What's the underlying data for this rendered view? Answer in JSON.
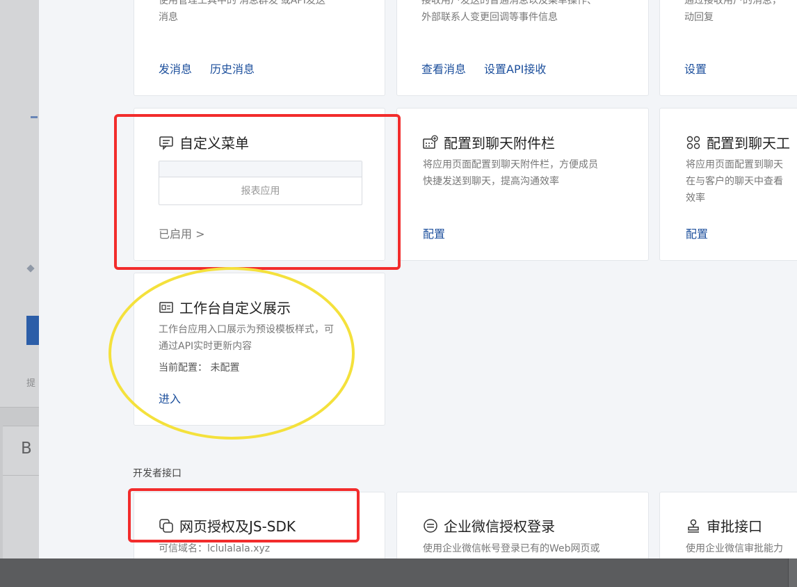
{
  "sidebar": {
    "tip_text": "提",
    "panel_letter": "B"
  },
  "cards": {
    "send_message": {
      "desc_line1": "使用管理工具中的'消息群发'或API发送",
      "desc_line2": "消息",
      "links": [
        "发消息",
        "历史消息"
      ]
    },
    "receive_message": {
      "desc_line1": "接收用户发送的普通消息以及菜单操作、",
      "desc_line2": "外部联系人变更回调等事件信息",
      "links": [
        "查看消息",
        "设置API接收"
      ]
    },
    "auto_reply": {
      "desc_line1": "通过接收用户的消息，",
      "desc_line2": "动回复",
      "links": [
        "设置"
      ]
    },
    "custom_menu": {
      "title": "自定义菜单",
      "icon": "menu-icon",
      "preview_label": "报表应用",
      "status": "已启用 >"
    },
    "chat_attachment": {
      "title": "配置到聊天附件栏",
      "icon": "attachment-bar-icon",
      "desc_line1": "将应用页面配置到聊天附件栏，方便成员",
      "desc_line2": "快捷发送到聊天，提高沟通效率",
      "link": "配置"
    },
    "chat_toolbar": {
      "title": "配置到聊天工",
      "icon": "toolbar-icon",
      "desc_line1": "将应用页面配置到聊天",
      "desc_line2": "在与客户的聊天中查看",
      "desc_line3": "效率",
      "link": "配置"
    },
    "workbench_display": {
      "title": "工作台自定义展示",
      "icon": "workbench-icon",
      "desc_line1": "工作台应用入口展示为预设模板样式，可",
      "desc_line2": "通过API实时更新内容",
      "config_line": "当前配置：  未配置",
      "link": "进入"
    }
  },
  "developer_section": {
    "label": "开发者接口",
    "web_auth": {
      "title": "网页授权及JS-SDK",
      "icon": "web-auth-icon",
      "desc": "可信域名：lclulalala.xyz"
    },
    "wework_login": {
      "title": "企业微信授权登录",
      "icon": "login-auth-icon",
      "desc": "使用企业微信帐号登录已有的Web网页或"
    },
    "approval_api": {
      "title": "审批接口",
      "icon": "approval-icon",
      "desc": "使用企业微信审批能力"
    }
  },
  "colors": {
    "link_blue": "#1c4f9c",
    "annotation_red": "#f22c2c",
    "annotation_yellow": "#f4e13c",
    "page_bg": "#f3f5f8"
  }
}
